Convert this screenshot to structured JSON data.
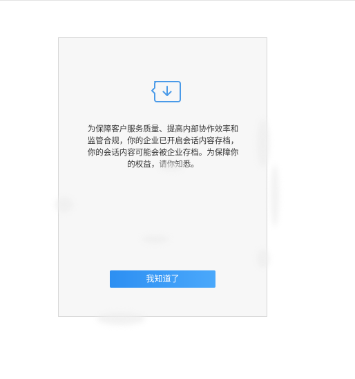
{
  "dialog": {
    "notice_lines": [
      "为保障客户服务质量、提高内部协作效率和",
      "监管合规，你的企业已开启会话内容存档，",
      "你的会话内容可能会被企业存档。为保障你",
      "的权益，请你知悉。"
    ],
    "confirm_label": "我知道了",
    "icon": "archive-download-icon"
  },
  "colors": {
    "accent": "#3a9cf7",
    "icon_stroke": "#4a9ae8",
    "text": "#333333",
    "dialog_background": "#f7f7f7"
  }
}
